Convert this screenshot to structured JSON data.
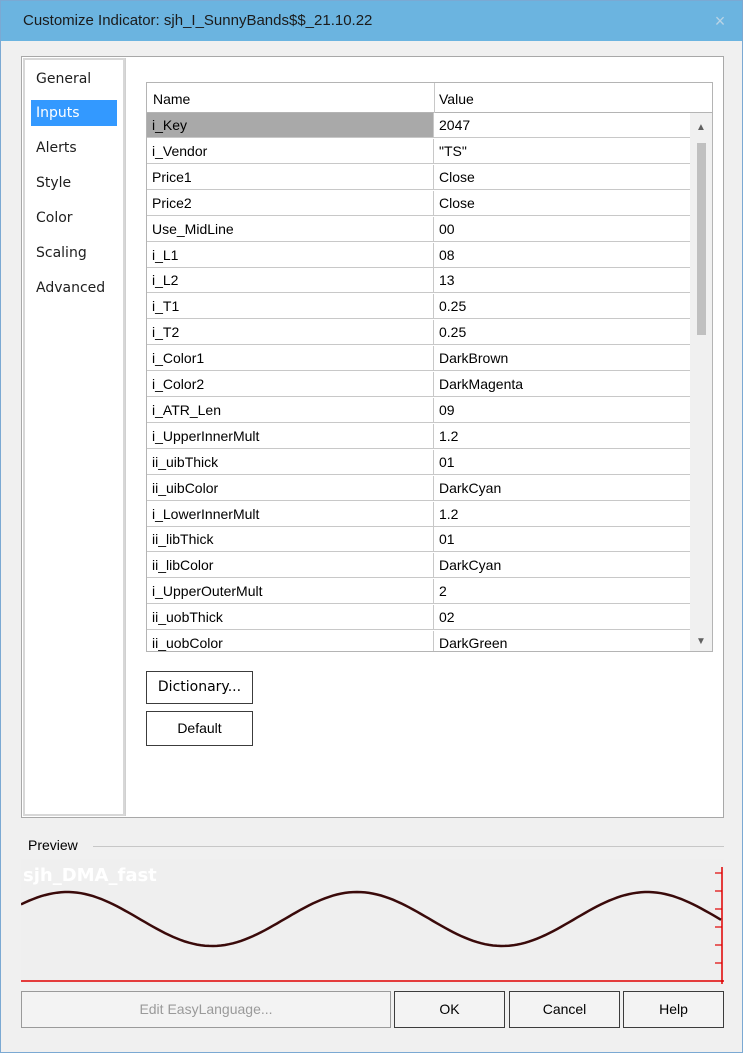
{
  "window": {
    "title": "Customize Indicator: sjh_I_SunnyBands$$_21.10.22",
    "close_glyph": "×"
  },
  "nav": {
    "items": [
      "General",
      "Inputs",
      "Alerts",
      "Style",
      "Color",
      "Scaling",
      "Advanced"
    ],
    "selected": "Inputs"
  },
  "inputs_table": {
    "columns": [
      "Name",
      "Value"
    ],
    "rows": [
      {
        "name": "i_Key",
        "value": "2047"
      },
      {
        "name": "i_Vendor",
        "value": "\"TS\""
      },
      {
        "name": "Price1",
        "value": "Close"
      },
      {
        "name": "Price2",
        "value": "Close"
      },
      {
        "name": "Use_MidLine",
        "value": "00"
      },
      {
        "name": "i_L1",
        "value": "08"
      },
      {
        "name": "i_L2",
        "value": "13"
      },
      {
        "name": "i_T1",
        "value": "0.25"
      },
      {
        "name": "i_T2",
        "value": "0.25"
      },
      {
        "name": "i_Color1",
        "value": "DarkBrown"
      },
      {
        "name": "i_Color2",
        "value": "DarkMagenta"
      },
      {
        "name": "i_ATR_Len",
        "value": "09"
      },
      {
        "name": "i_UpperInnerMult",
        "value": "1.2"
      },
      {
        "name": "ii_uibThick",
        "value": "01"
      },
      {
        "name": "ii_uibColor",
        "value": "DarkCyan"
      },
      {
        "name": "i_LowerInnerMult",
        "value": "1.2"
      },
      {
        "name": "ii_libThick",
        "value": "01"
      },
      {
        "name": "ii_libColor",
        "value": "DarkCyan"
      },
      {
        "name": "i_UpperOuterMult",
        "value": "2"
      },
      {
        "name": "ii_uobThick",
        "value": "02"
      },
      {
        "name": "ii_uobColor",
        "value": "DarkGreen"
      }
    ],
    "selected_row": 0
  },
  "buttons": {
    "dictionary": "Dictionary...",
    "default": "Default",
    "edit_easylanguage": "Edit EasyLanguage...",
    "ok": "OK",
    "cancel": "Cancel",
    "help": "Help"
  },
  "preview": {
    "label": "Preview",
    "chart_title": "sjh_DMA_fast"
  },
  "colors": {
    "titlebar": "#6bb4e0",
    "nav_selected": "#3399ff",
    "row_selected": "#a9a9a9",
    "wave": "#3a0a0a",
    "axis": "#e00000"
  }
}
